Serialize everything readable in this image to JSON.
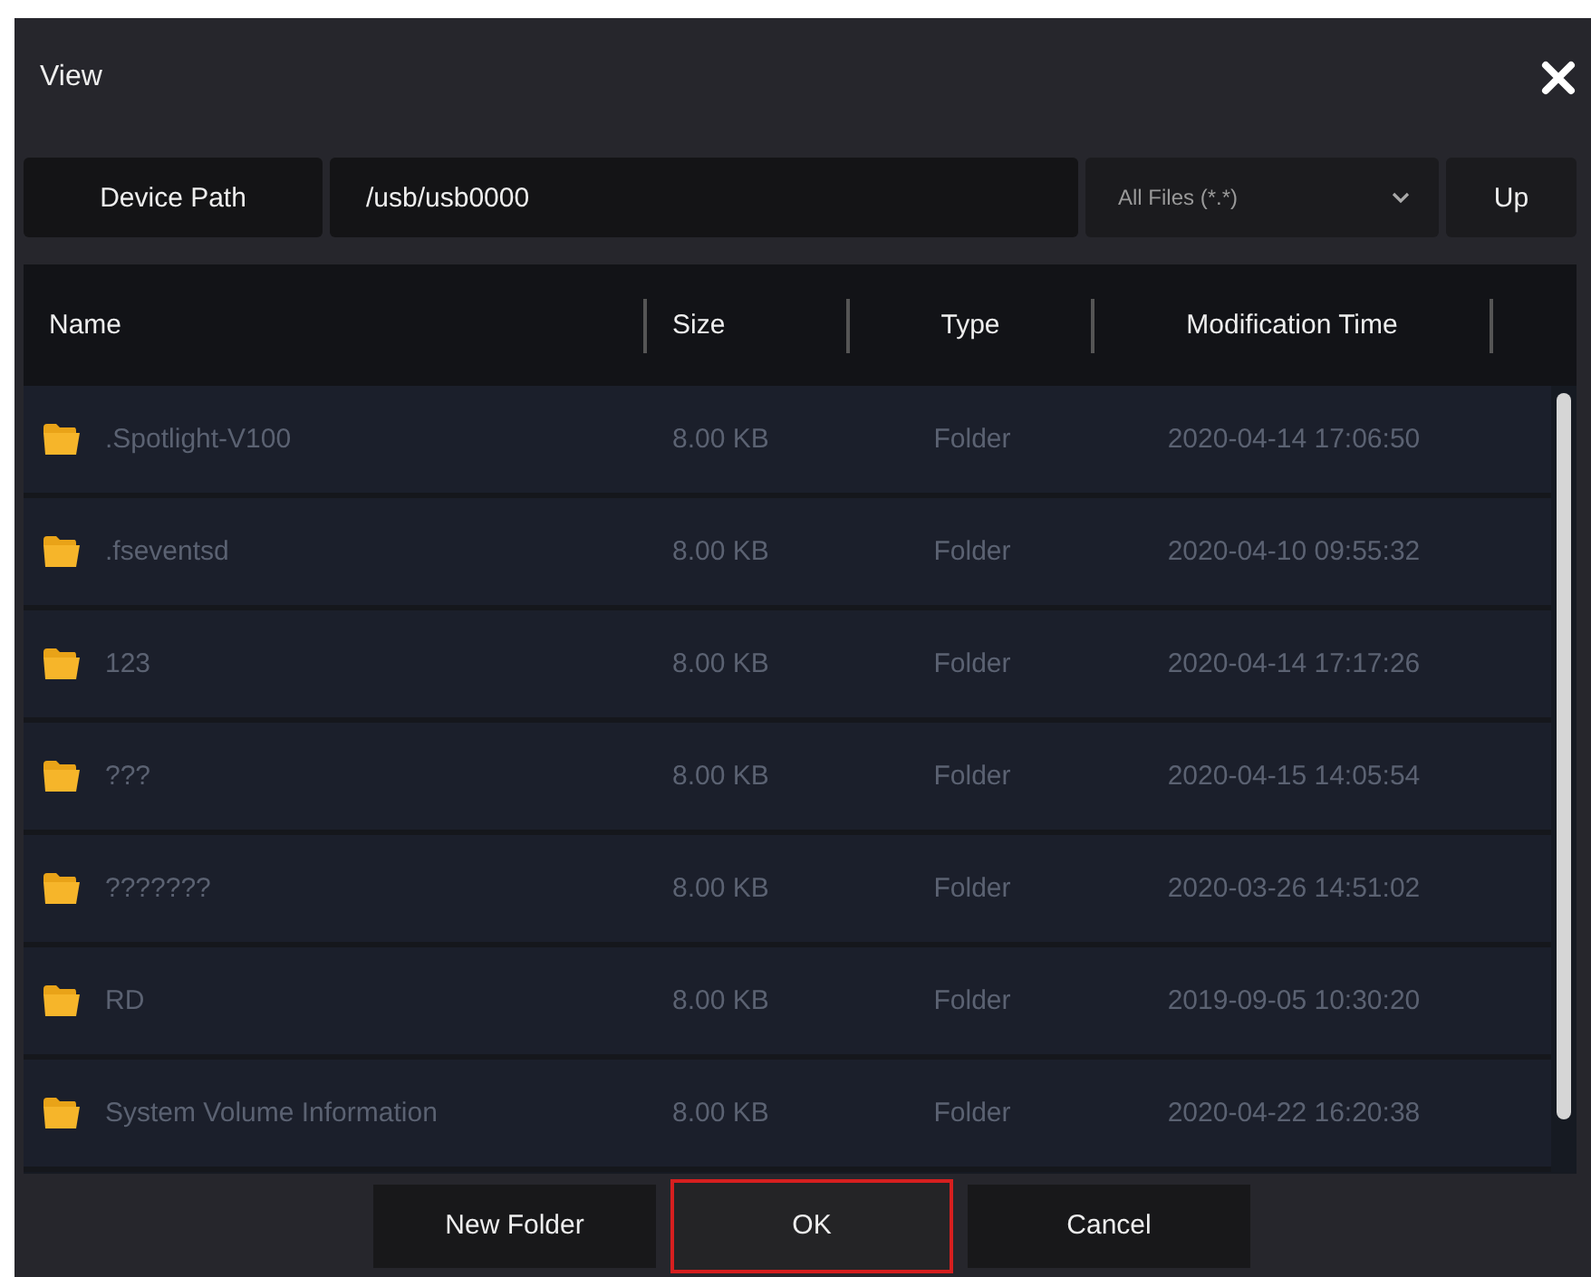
{
  "window": {
    "title": "View"
  },
  "toolbar": {
    "path_label": "Device Path",
    "path": "/usb/usb0000",
    "filter": "All Files (*.*)",
    "up": "Up"
  },
  "table": {
    "columns": [
      "Name",
      "Size",
      "Type",
      "Modification Time"
    ],
    "rows": [
      {
        "name": ".Spotlight-V100",
        "size": "8.00 KB",
        "type": "Folder",
        "time": "2020-04-14 17:06:50"
      },
      {
        "name": ".fseventsd",
        "size": "8.00 KB",
        "type": "Folder",
        "time": "2020-04-10 09:55:32"
      },
      {
        "name": "123",
        "size": "8.00 KB",
        "type": "Folder",
        "time": "2020-04-14 17:17:26"
      },
      {
        "name": "???",
        "size": "8.00 KB",
        "type": "Folder",
        "time": "2020-04-15 14:05:54"
      },
      {
        "name": "???????",
        "size": "8.00 KB",
        "type": "Folder",
        "time": "2020-03-26 14:51:02"
      },
      {
        "name": "RD",
        "size": "8.00 KB",
        "type": "Folder",
        "time": "2019-09-05 10:30:20"
      },
      {
        "name": "System Volume Information",
        "size": "8.00 KB",
        "type": "Folder",
        "time": "2020-04-22 16:20:38"
      }
    ]
  },
  "buttons": [
    {
      "label": "New Folder",
      "selected": false
    },
    {
      "label": "OK",
      "selected": true
    },
    {
      "label": "Cancel",
      "selected": false
    }
  ]
}
